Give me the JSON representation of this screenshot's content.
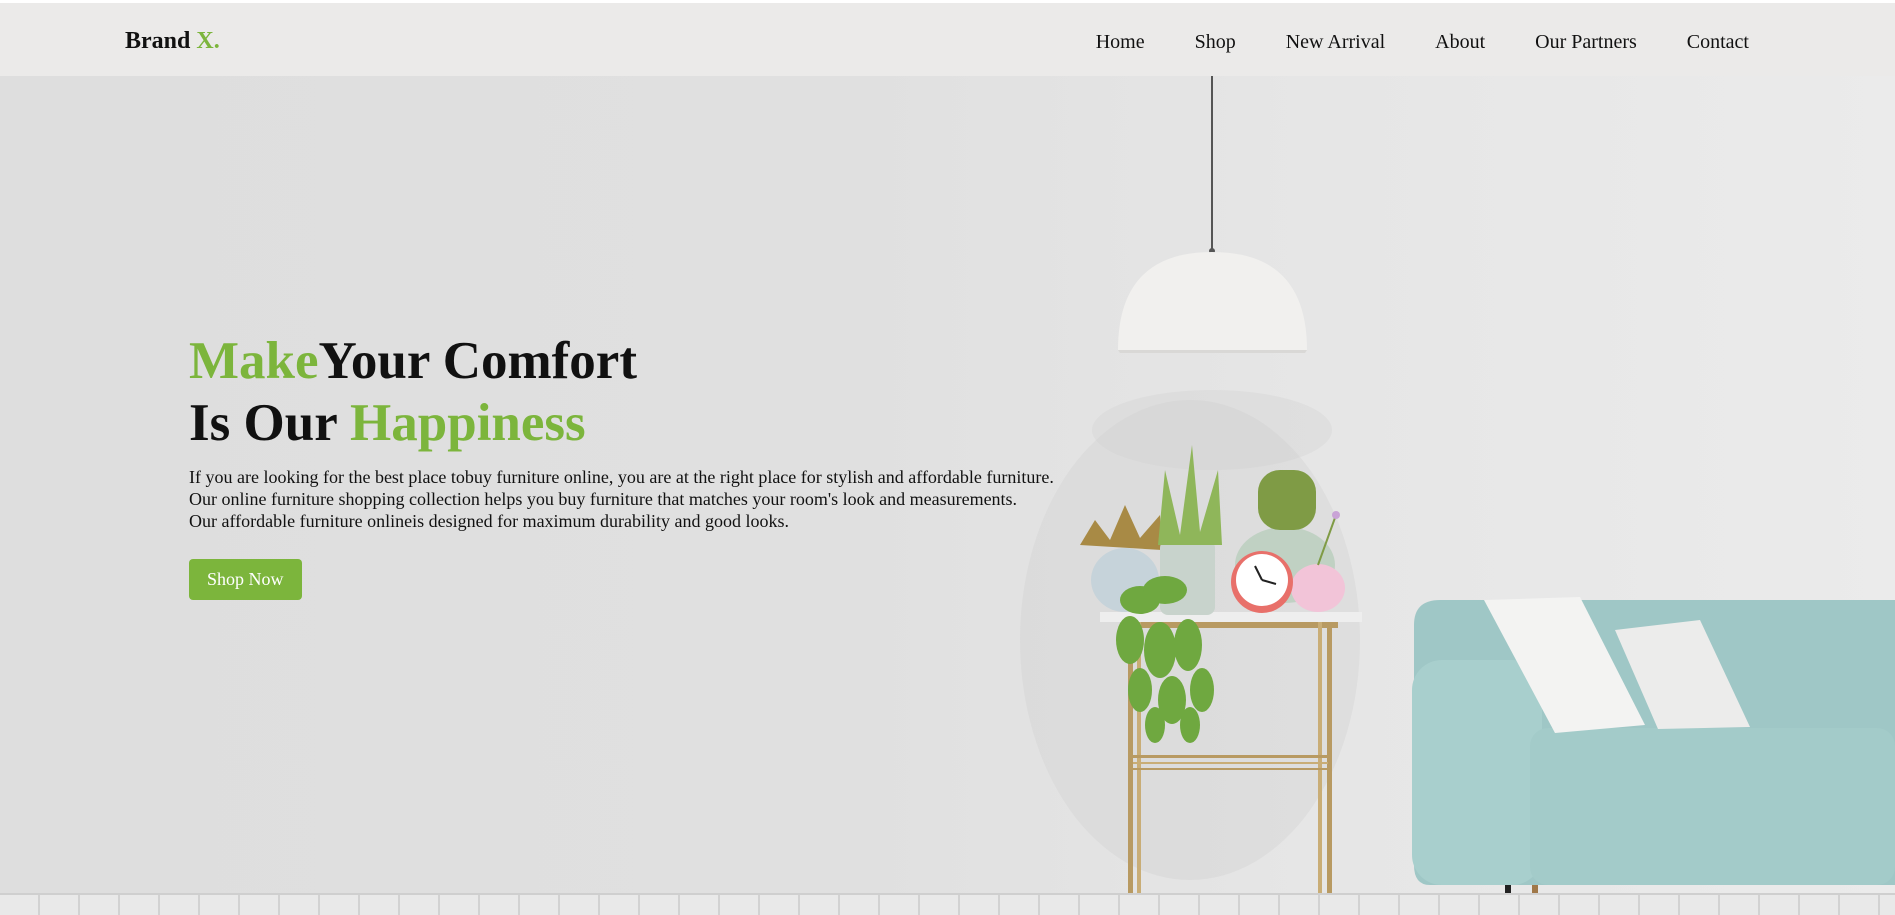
{
  "brand": {
    "name": "Brand",
    "mark": "X."
  },
  "nav": {
    "home": "Home",
    "shop": "Shop",
    "new_arrival": "New Arrival",
    "about": "About",
    "partners": "Our Partners",
    "contact": "Contact"
  },
  "hero": {
    "line1_green": "Make",
    "line1_rest": "Your Comfort",
    "line2_start": "Is Our ",
    "line2_green": "Happiness",
    "desc_1": "If you are looking for the best place tobuy furniture online, you are at the right place for stylish and affordable furniture.",
    "desc_2": "Our online furniture shopping collection helps you buy furniture that matches your room's look and measurements.",
    "desc_3": "Our affordable furniture onlineis designed for maximum durability and good looks.",
    "cta": "Shop Now"
  },
  "colors": {
    "accent": "#7cb53c",
    "text": "#111111",
    "navbar": "#ebeae9"
  }
}
